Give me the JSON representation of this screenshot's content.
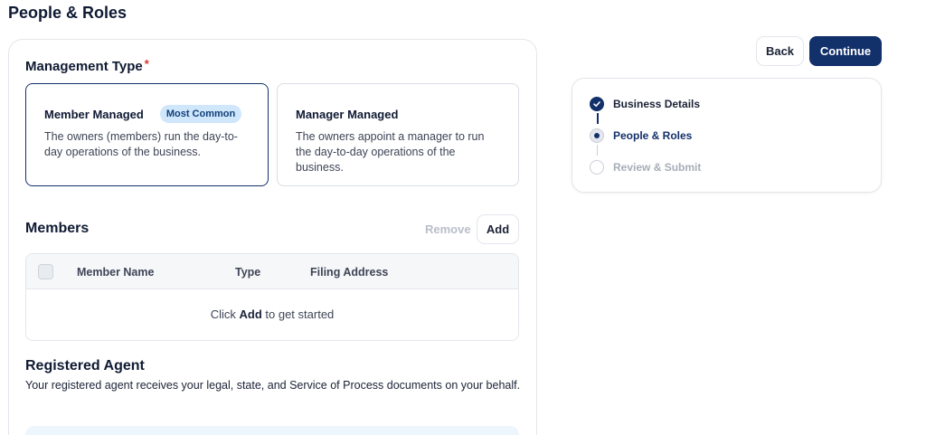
{
  "page": {
    "title": "People & Roles"
  },
  "management": {
    "label": "Management Type",
    "required_mark": "*",
    "options": [
      {
        "title": "Member Managed",
        "badge": "Most Common",
        "description": "The owners (members) run the day-to-day operations of the business.",
        "selected": true
      },
      {
        "title": "Manager Managed",
        "description": "The owners appoint a manager to run the day-to-day operations of the business.",
        "selected": false
      }
    ]
  },
  "members": {
    "title": "Members",
    "remove_label": "Remove",
    "add_label": "Add",
    "columns": [
      "Member Name",
      "Type",
      "Filing Address"
    ],
    "empty_prefix": "Click ",
    "empty_action": "Add",
    "empty_suffix": " to get started"
  },
  "agent": {
    "title": "Registered Agent",
    "description": "Your registered agent receives your legal, state, and Service of Process documents on your behalf."
  },
  "actions": {
    "back_label": "Back",
    "continue_label": "Continue"
  },
  "steps": [
    {
      "label": "Business Details",
      "status": "done"
    },
    {
      "label": "People & Roles",
      "status": "current"
    },
    {
      "label": "Review & Submit",
      "status": "todo"
    }
  ],
  "colors": {
    "primary": "#12306a",
    "badge_bg": "#cfe6fb",
    "muted": "#b9bec8",
    "required": "#d9342b"
  }
}
